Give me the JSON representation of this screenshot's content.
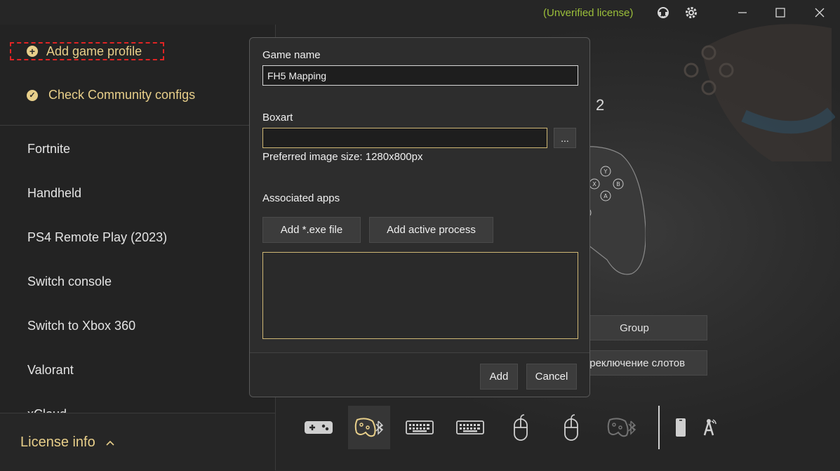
{
  "titlebar": {
    "license_status": "(Unverified license)",
    "icons": [
      "support-icon",
      "settings-gear-icon",
      "minimize-icon",
      "maximize-icon",
      "close-icon"
    ]
  },
  "sidebar": {
    "add_profile_label": "Add game profile",
    "check_configs_label": "Check Community configs",
    "profiles": [
      "Fortnite",
      "Handheld",
      "PS4 Remote Play (2023)",
      "Switch console",
      "Switch to Xbox 360",
      "Valorant",
      "xCloud"
    ],
    "license_info_label": "License info"
  },
  "background": {
    "slot_number": "2",
    "group_button": "Group",
    "slot_switch_button": "ереключение слотов",
    "controller_buttons": [
      "Y",
      "X",
      "B",
      "A"
    ]
  },
  "toolbar": {
    "icons": [
      "gamepad-icon",
      "gamepad-bluetooth-icon",
      "keyboard-icon",
      "keyboard-alt-icon",
      "mouse-icon",
      "mouse-alt-icon",
      "gamepad-bluetooth-disabled-icon",
      "phone-icon",
      "antenna-icon"
    ],
    "selected_index": 1
  },
  "dialog": {
    "game_name_label": "Game name",
    "game_name_value": "FH5 Mapping",
    "boxart_label": "Boxart",
    "boxart_value": "",
    "browse_label": "...",
    "image_hint": "Preferred image size: 1280x800px",
    "associated_apps_label": "Associated apps",
    "add_exe_button": "Add *.exe file",
    "add_process_button": "Add active process",
    "add_button": "Add",
    "cancel_button": "Cancel"
  },
  "colors": {
    "accent": "#e8cf8a",
    "license_status": "#9bbf3a",
    "highlight_border": "#e02424"
  }
}
